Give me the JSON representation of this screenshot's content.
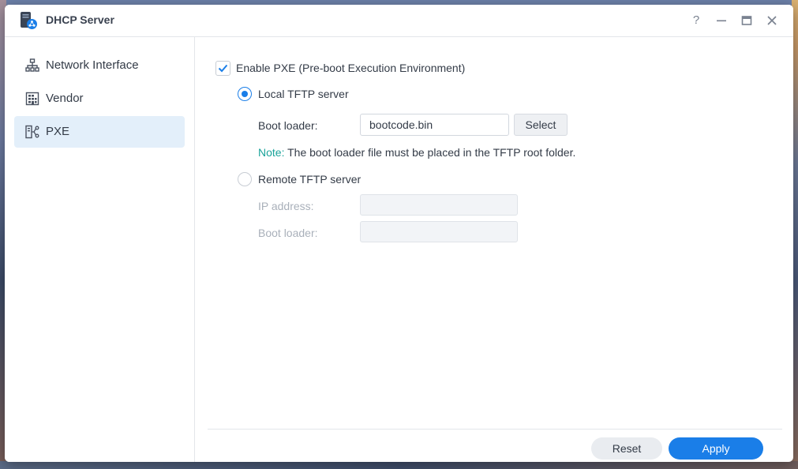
{
  "window": {
    "title": "DHCP Server"
  },
  "controls": {
    "help": "?",
    "minimize": "—",
    "maximize": "▭",
    "close": "✕"
  },
  "sidebar": {
    "items": [
      {
        "label": "Network Interface",
        "icon": "network-tree-icon"
      },
      {
        "label": "Vendor",
        "icon": "building-icon"
      },
      {
        "label": "PXE",
        "icon": "pxe-icon",
        "active": true
      }
    ]
  },
  "pxe": {
    "enable_label": "Enable PXE (Pre-boot Execution Environment)",
    "enable_checked": true,
    "local": {
      "label": "Local TFTP server",
      "selected": true,
      "boot_loader_label": "Boot loader:",
      "boot_loader_value": "bootcode.bin",
      "select_button": "Select",
      "note_label": "Note:",
      "note_text": " The boot loader file must be placed in the TFTP root folder."
    },
    "remote": {
      "label": "Remote TFTP server",
      "selected": false,
      "ip_label": "IP address:",
      "ip_value": "",
      "boot_loader_label": "Boot loader:",
      "boot_loader_value": ""
    }
  },
  "footer": {
    "reset": "Reset",
    "apply": "Apply"
  },
  "colors": {
    "accent": "#1a7ee8",
    "note": "#1aa39a",
    "active_nav": "#e3effa"
  }
}
